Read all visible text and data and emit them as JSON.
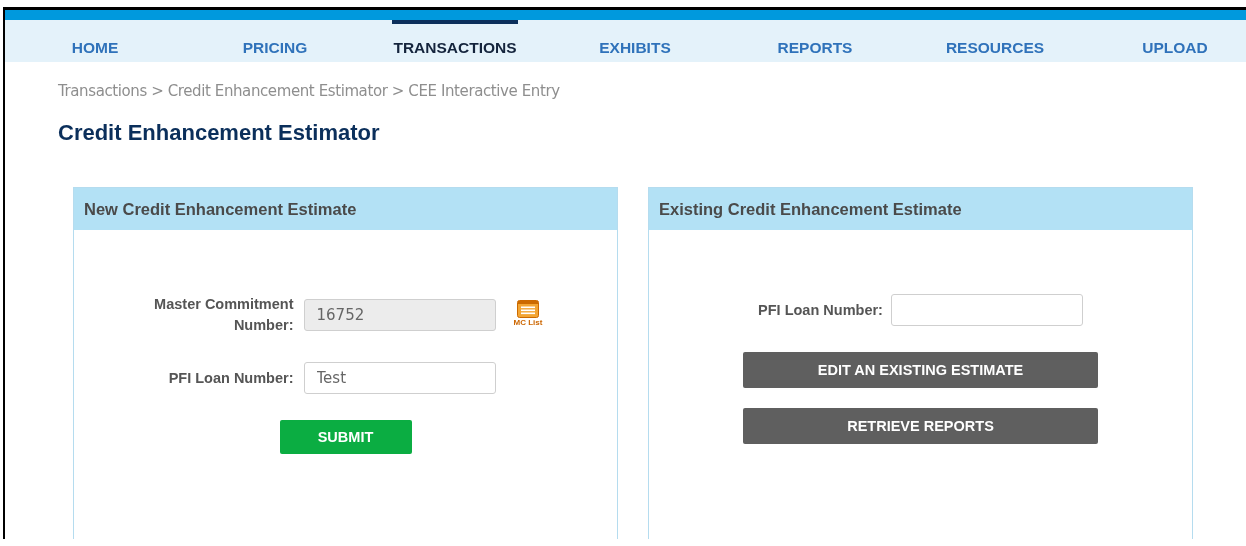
{
  "nav": {
    "items": [
      {
        "label": "HOME",
        "selected": false
      },
      {
        "label": "PRICING",
        "selected": false
      },
      {
        "label": "TRANSACTIONS",
        "selected": true
      },
      {
        "label": "EXHIBITS",
        "selected": false
      },
      {
        "label": "REPORTS",
        "selected": false
      },
      {
        "label": "RESOURCES",
        "selected": false
      },
      {
        "label": "UPLOAD",
        "selected": false
      }
    ]
  },
  "breadcrumb": "Transactions > Credit Enhancement Estimator > CEE Interactive Entry",
  "page_title": "Credit Enhancement Estimator",
  "panels": [
    {
      "title": "New Credit Enhancement Estimate",
      "fields": [
        {
          "label": "Master Commitment Number:",
          "value": "16752",
          "disabled": true,
          "lookup": "MC List"
        },
        {
          "label": "PFI Loan Number:",
          "value": "Test",
          "disabled": false
        }
      ],
      "buttons": [
        {
          "label": "SUBMIT",
          "kind": "primary"
        }
      ]
    },
    {
      "title": "Existing Credit Enhancement Estimate",
      "fields": [
        {
          "label": "PFI Loan Number:",
          "disabled": false
        }
      ],
      "buttons": [
        {
          "label": "EDIT AN EXISTING ESTIMATE",
          "kind": "secondary"
        },
        {
          "label": "RETRIEVE REPORTS",
          "kind": "secondary"
        }
      ]
    }
  ]
}
